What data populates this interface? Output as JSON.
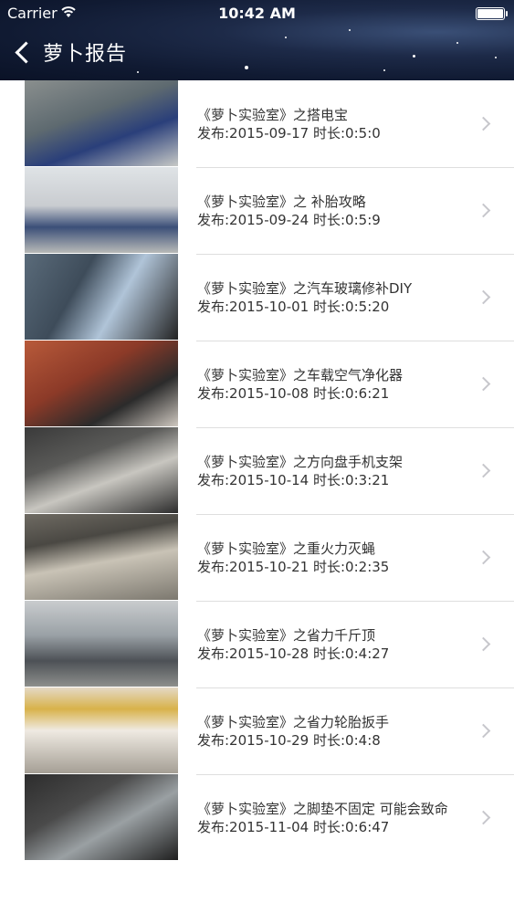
{
  "status_bar": {
    "carrier": "Carrier",
    "time": "10:42 AM"
  },
  "nav": {
    "back_icon": "chevron-left-icon",
    "title": "萝卜报告"
  },
  "items": [
    {
      "title": "《萝卜实验室》之搭电宝",
      "meta": "发布:2015-09-17 时长:0:5:0"
    },
    {
      "title": "《萝卜实验室》之 补胎攻略",
      "meta": "发布:2015-09-24 时长:0:5:9"
    },
    {
      "title": "《萝卜实验室》之汽车玻璃修补DIY",
      "meta": "发布:2015-10-01 时长:0:5:20"
    },
    {
      "title": "《萝卜实验室》之车载空气净化器",
      "meta": "发布:2015-10-08 时长:0:6:21"
    },
    {
      "title": "《萝卜实验室》之方向盘手机支架",
      "meta": "发布:2015-10-14 时长:0:3:21"
    },
    {
      "title": "《萝卜实验室》之重火力灭蝇",
      "meta": "发布:2015-10-21 时长:0:2:35"
    },
    {
      "title": "《萝卜实验室》之省力千斤顶",
      "meta": "发布:2015-10-28 时长:0:4:27"
    },
    {
      "title": "《萝卜实验室》之省力轮胎扳手",
      "meta": "发布:2015-10-29 时长:0:4:8"
    },
    {
      "title": "《萝卜实验室》之脚垫不固定 可能会致命",
      "meta": "发布:2015-11-04 时长:0:6:47"
    }
  ]
}
